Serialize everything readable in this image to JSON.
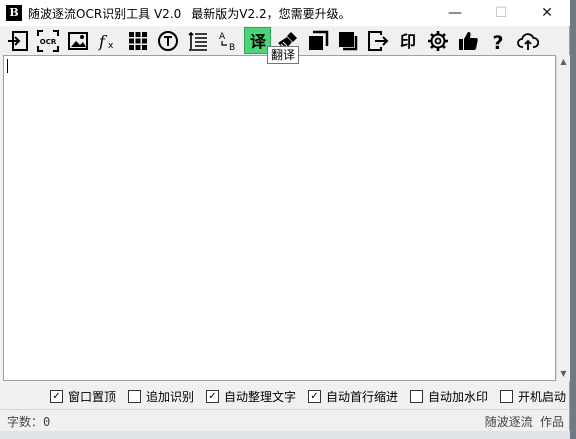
{
  "title": {
    "app": "随波逐流OCR识别工具 V2.0",
    "update": "最新版为V2.2，您需要升级。"
  },
  "window_controls": {
    "min": "—",
    "max": "☐",
    "close": "✕"
  },
  "toolbar": {
    "tooltip": "翻译",
    "items": [
      {
        "name": "import-icon"
      },
      {
        "name": "ocr-icon"
      },
      {
        "name": "image-icon"
      },
      {
        "name": "formula-icon"
      },
      {
        "name": "grid-icon"
      },
      {
        "name": "text-icon"
      },
      {
        "name": "align-icon"
      },
      {
        "name": "ab-icon"
      },
      {
        "name": "translate-icon",
        "label": "译",
        "active": true
      },
      {
        "name": "broom-icon"
      },
      {
        "name": "window-front-icon"
      },
      {
        "name": "window-back-icon"
      },
      {
        "name": "exit-icon"
      },
      {
        "name": "stamp-icon",
        "label": "印"
      },
      {
        "name": "gear-icon"
      },
      {
        "name": "thumbs-up-icon"
      },
      {
        "name": "help-icon",
        "label": "?"
      },
      {
        "name": "cloud-upload-icon"
      }
    ]
  },
  "editor": {
    "text": ""
  },
  "options": [
    {
      "label": "窗口置顶",
      "checked": true
    },
    {
      "label": "追加识别",
      "checked": false
    },
    {
      "label": "自动整理文字",
      "checked": true
    },
    {
      "label": "自动首行缩进",
      "checked": true
    },
    {
      "label": "自动加水印",
      "checked": false
    },
    {
      "label": "开机启动",
      "checked": false
    }
  ],
  "status": {
    "count_label": "字数：",
    "count_value": "0",
    "author": "随波逐流 作品"
  },
  "colors": {
    "active_button": "#4bd47a",
    "background": "#f0f0f0"
  }
}
